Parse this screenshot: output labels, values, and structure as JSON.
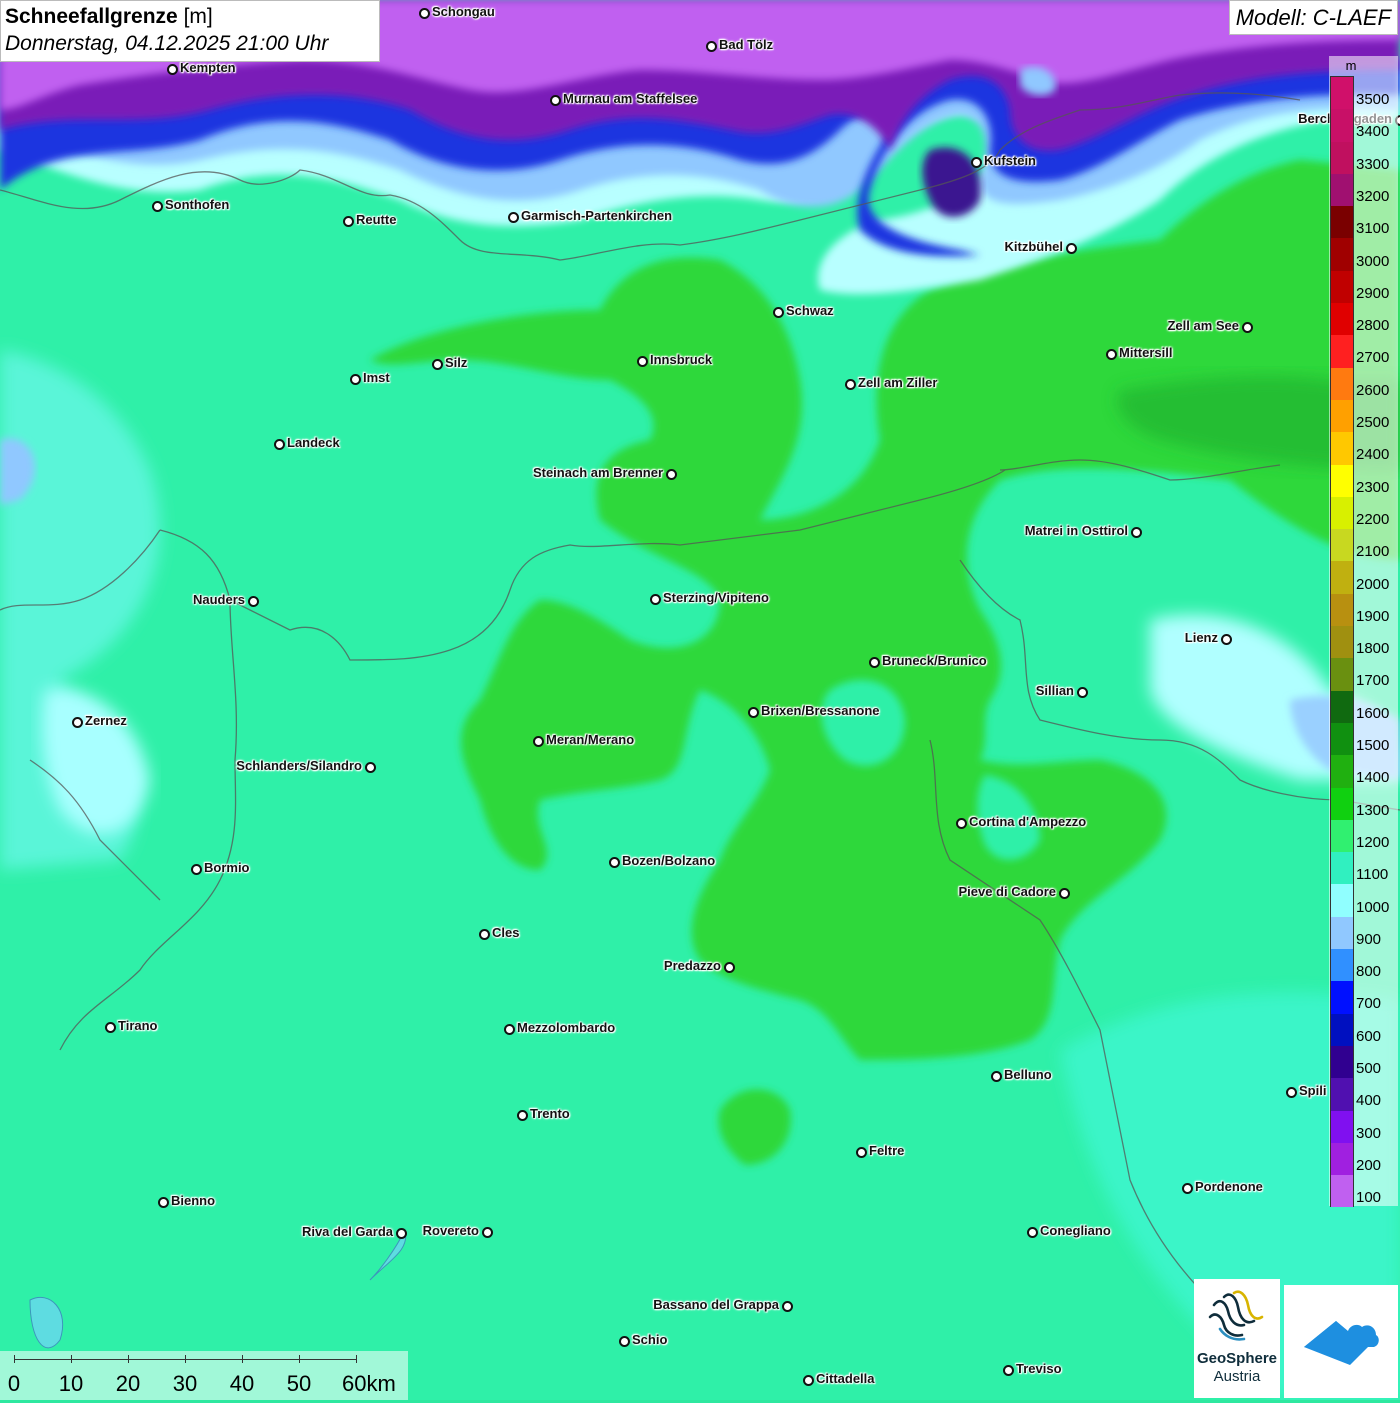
{
  "title": {
    "main": "Schneefallgrenze",
    "unit": "[m]",
    "datetime": "Donnerstag, 04.12.2025 21:00 Uhr"
  },
  "model": "Modell: C-LAEF",
  "legend": {
    "unit": "m",
    "levels": [
      {
        "label": "3500",
        "color": "#d0106a"
      },
      {
        "label": "3400",
        "color": "#c81067"
      },
      {
        "label": "3300",
        "color": "#c0105f"
      },
      {
        "label": "3200",
        "color": "#a01070"
      },
      {
        "label": "3100",
        "color": "#7a0000"
      },
      {
        "label": "3000",
        "color": "#a00000"
      },
      {
        "label": "2900",
        "color": "#c00000"
      },
      {
        "label": "2800",
        "color": "#e00000"
      },
      {
        "label": "2700",
        "color": "#ff2020"
      },
      {
        "label": "2600",
        "color": "#ff7a10"
      },
      {
        "label": "2500",
        "color": "#ffa000"
      },
      {
        "label": "2400",
        "color": "#ffc800"
      },
      {
        "label": "2300",
        "color": "#ffff00"
      },
      {
        "label": "2200",
        "color": "#d8f000"
      },
      {
        "label": "2100",
        "color": "#c8d820"
      },
      {
        "label": "2000",
        "color": "#c0b010"
      },
      {
        "label": "1900",
        "color": "#b89010"
      },
      {
        "label": "1800",
        "color": "#a09010"
      },
      {
        "label": "1700",
        "color": "#6a9010"
      },
      {
        "label": "1600",
        "color": "#106a10"
      },
      {
        "label": "1500",
        "color": "#109010"
      },
      {
        "label": "1400",
        "color": "#20b010"
      },
      {
        "label": "1300",
        "color": "#10d010"
      },
      {
        "label": "1200",
        "color": "#30f070"
      },
      {
        "label": "1100",
        "color": "#30f0c0"
      },
      {
        "label": "1000",
        "color": "#90ffff"
      },
      {
        "label": "900",
        "color": "#90c8ff"
      },
      {
        "label": "800",
        "color": "#3090ff"
      },
      {
        "label": "700",
        "color": "#0010ff"
      },
      {
        "label": "600",
        "color": "#0010c0"
      },
      {
        "label": "500",
        "color": "#300090"
      },
      {
        "label": "400",
        "color": "#5010b0"
      },
      {
        "label": "300",
        "color": "#8010f0"
      },
      {
        "label": "200",
        "color": "#a020e0"
      },
      {
        "label": "100",
        "color": "#c060f0"
      }
    ]
  },
  "scale": {
    "labels": [
      "0",
      "10",
      "20",
      "30",
      "40",
      "50",
      "60km"
    ]
  },
  "logo": {
    "name": "GeoSphere",
    "sub": "Austria"
  },
  "colors": {
    "low_band_purple": "#c060f0",
    "deep_blue": "#1020c0",
    "light_cyan": "#b8ffff",
    "base_turquoise": "#30f0b0",
    "green_zone": "#2ed83a"
  },
  "cities": [
    {
      "name": "Schongau",
      "label": "Schongau"
    },
    {
      "name": "Bad Tölz",
      "label": "Bad Tölz"
    },
    {
      "name": "Kempten",
      "label": "Kempten"
    },
    {
      "name": "Murnau am Staffelsee",
      "label": "Murnau am Staffelsee"
    },
    {
      "name": "Berchtesgaden",
      "label": "Berchtesgaden"
    },
    {
      "name": "Kufstein",
      "label": "Kufstein"
    },
    {
      "name": "Sonthofen",
      "label": "Sonthofen"
    },
    {
      "name": "Reutte",
      "label": "Reutte"
    },
    {
      "name": "Garmisch-Partenkirchen",
      "label": "Garmisch-Partenkirchen"
    },
    {
      "name": "Kitzbühel",
      "label": "Kitzbühel"
    },
    {
      "name": "Schwaz",
      "label": "Schwaz"
    },
    {
      "name": "Zell am See",
      "label": "Zell am See"
    },
    {
      "name": "Innsbruck",
      "label": "Innsbruck"
    },
    {
      "name": "Mittersill",
      "label": "Mittersill"
    },
    {
      "name": "Silz",
      "label": "Silz"
    },
    {
      "name": "Imst",
      "label": "Imst"
    },
    {
      "name": "Zell am Ziller",
      "label": "Zell am Ziller"
    },
    {
      "name": "Landeck",
      "label": "Landeck"
    },
    {
      "name": "Steinach am Brenner",
      "label": "Steinach am Brenner"
    },
    {
      "name": "Matrei in Osttirol",
      "label": "Matrei in Osttirol"
    },
    {
      "name": "Nauders",
      "label": "Nauders"
    },
    {
      "name": "Sterzing/Vipiteno",
      "label": "Sterzing/Vipiteno"
    },
    {
      "name": "Lienz",
      "label": "Lienz"
    },
    {
      "name": "Bruneck/Brunico",
      "label": "Bruneck/Brunico"
    },
    {
      "name": "Sillian",
      "label": "Sillian"
    },
    {
      "name": "Brixen/Bressanone",
      "label": "Brixen/Bressanone"
    },
    {
      "name": "Zernez",
      "label": "Zernez"
    },
    {
      "name": "Meran/Merano",
      "label": "Meran/Merano"
    },
    {
      "name": "Schlanders/Silandro",
      "label": "Schlanders/Silandro"
    },
    {
      "name": "Cortina d'Ampezzo",
      "label": "Cortina d'Ampezzo"
    },
    {
      "name": "Bormio",
      "label": "Bormio"
    },
    {
      "name": "Bozen/Bolzano",
      "label": "Bozen/Bolzano"
    },
    {
      "name": "Pieve di Cadore",
      "label": "Pieve di Cadore"
    },
    {
      "name": "Cles",
      "label": "Cles"
    },
    {
      "name": "Predazzo",
      "label": "Predazzo"
    },
    {
      "name": "Tirano",
      "label": "Tirano"
    },
    {
      "name": "Mezzolombardo",
      "label": "Mezzolombardo"
    },
    {
      "name": "Belluno",
      "label": "Belluno"
    },
    {
      "name": "Spilimbergo",
      "label": "Spili"
    },
    {
      "name": "Trento",
      "label": "Trento"
    },
    {
      "name": "Feltre",
      "label": "Feltre"
    },
    {
      "name": "Pordenone",
      "label": "Pordenone"
    },
    {
      "name": "Bienno",
      "label": "Bienno"
    },
    {
      "name": "Riva del Garda",
      "label": "Riva del Garda"
    },
    {
      "name": "Rovereto",
      "label": "Rovereto"
    },
    {
      "name": "Conegliano",
      "label": "Conegliano"
    },
    {
      "name": "Bassano del Grappa",
      "label": "Bassano del Grappa"
    },
    {
      "name": "Schio",
      "label": "Schio"
    },
    {
      "name": "Treviso",
      "label": "Treviso"
    },
    {
      "name": "Cittadella",
      "label": "Cittadella"
    }
  ]
}
